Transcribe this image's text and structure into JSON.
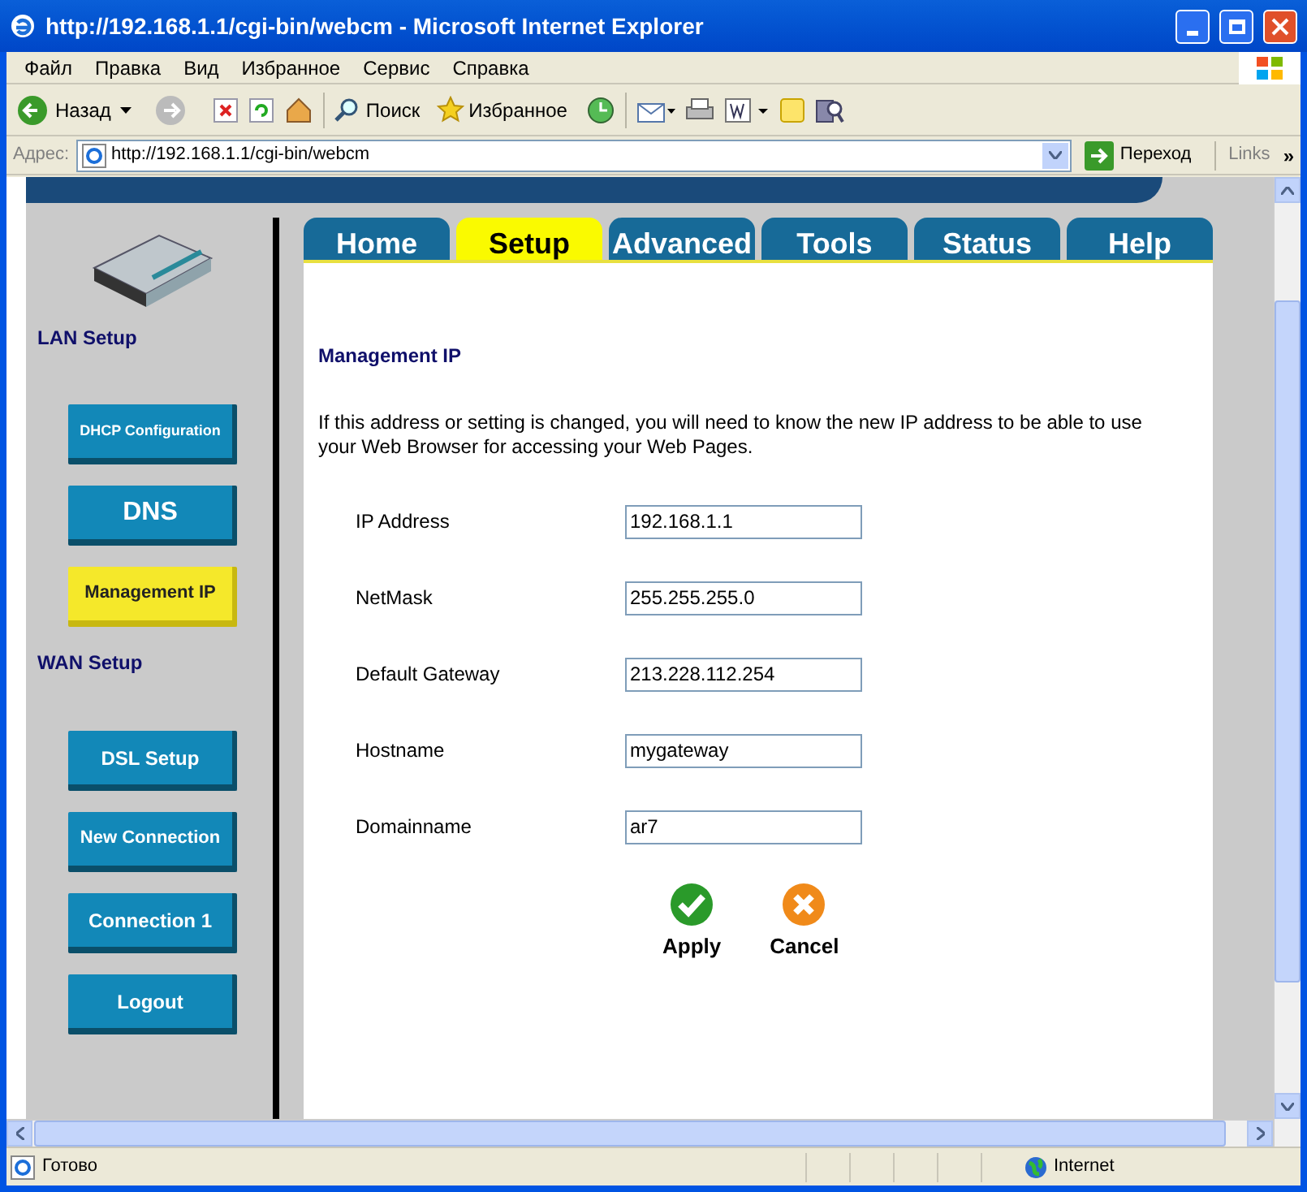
{
  "window": {
    "title": "http://192.168.1.1/cgi-bin/webcm - Microsoft Internet Explorer"
  },
  "menu": [
    "Файл",
    "Правка",
    "Вид",
    "Избранное",
    "Сервис",
    "Справка"
  ],
  "toolbar": {
    "back": "Назад",
    "search": "Поиск",
    "favorites": "Избранное"
  },
  "address_bar": {
    "label": "Адрес:",
    "url": "http://192.168.1.1/cgi-bin/webcm",
    "go": "Переход",
    "links": "Links",
    "more": "»"
  },
  "sidebar": [
    {
      "title": "LAN Setup",
      "items": [
        {
          "label": "DHCP Configuration",
          "selected": false
        },
        {
          "label": "DNS",
          "selected": false
        },
        {
          "label": "Management IP",
          "selected": true
        }
      ]
    },
    {
      "title": "WAN Setup",
      "items": [
        {
          "label": "DSL Setup",
          "selected": false
        },
        {
          "label": "New Connection",
          "selected": false
        },
        {
          "label": "Connection 1",
          "selected": false
        },
        {
          "label": "Logout",
          "selected": false
        }
      ]
    }
  ],
  "tabs": [
    {
      "label": "Home",
      "selected": false
    },
    {
      "label": "Setup",
      "selected": true
    },
    {
      "label": "Advanced",
      "selected": false
    },
    {
      "label": "Tools",
      "selected": false
    },
    {
      "label": "Status",
      "selected": false
    },
    {
      "label": "Help",
      "selected": false
    }
  ],
  "heading": "Management IP",
  "description": "If this address or setting is changed, you will need to know the new IP address to be able to use your Web Browser for accessing your Web Pages.",
  "fields": [
    {
      "label": "IP Address",
      "value": "192.168.1.1"
    },
    {
      "label": "NetMask",
      "value": "255.255.255.0"
    },
    {
      "label": "Default Gateway",
      "value": "213.228.112.254"
    },
    {
      "label": "Hostname",
      "value": "mygateway"
    },
    {
      "label": "Domainname",
      "value": "ar7"
    }
  ],
  "actions": [
    {
      "kind": "apply",
      "label": "Apply"
    },
    {
      "kind": "cancel",
      "label": "Cancel"
    }
  ],
  "status_bar": {
    "text": "Готово",
    "zone": "Internet"
  }
}
